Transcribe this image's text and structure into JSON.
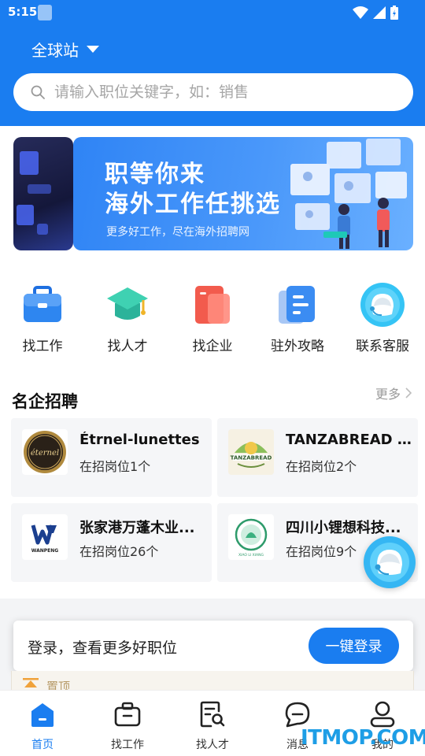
{
  "status_bar": {
    "time": "5:15"
  },
  "header": {
    "region": "全球站",
    "search_placeholder": "请输入职位关键字，如：销售"
  },
  "banner": {
    "line1": "职等你来",
    "line2": "海外工作任挑选",
    "subtitle": "更多好工作，尽在海外招聘网"
  },
  "quick_actions": [
    {
      "label": "找工作",
      "icon": "briefcase-icon"
    },
    {
      "label": "找人才",
      "icon": "graduation-cap-icon"
    },
    {
      "label": "找企业",
      "icon": "company-icon"
    },
    {
      "label": "驻外攻略",
      "icon": "guide-icon"
    },
    {
      "label": "联系客服",
      "icon": "customer-service-icon"
    }
  ],
  "companies": {
    "title": "名企招聘",
    "more": "更多",
    "items": [
      {
        "name": "Étrnel-lunettes",
        "count": "在招岗位1个",
        "logo_text": "éternel"
      },
      {
        "name": "TANZABREAD C...",
        "count": "在招岗位2个",
        "logo_text": "TANZABREAD"
      },
      {
        "name": "张家港万蓬木业...",
        "count": "在招岗位26个",
        "logo_text": "WANPENG"
      },
      {
        "name": "四川小锂想科技...",
        "count": "在招岗位9个",
        "logo_text": "XIAO LI XIANG"
      }
    ]
  },
  "login_bar": {
    "text": "登录，查看更多好职位",
    "button": "一键登录"
  },
  "pinned": {
    "text": "置顶"
  },
  "tabbar": [
    {
      "label": "首页",
      "icon": "home-icon",
      "active": true
    },
    {
      "label": "找工作",
      "icon": "briefcase-icon",
      "active": false
    },
    {
      "label": "找人才",
      "icon": "resume-search-icon",
      "active": false
    },
    {
      "label": "消息",
      "icon": "message-icon",
      "active": false
    },
    {
      "label": "我的",
      "icon": "user-icon",
      "active": false
    }
  ],
  "watermark": "ITMOP.COM",
  "colors": {
    "primary": "#1a7df0",
    "service": "#35b6f3"
  }
}
